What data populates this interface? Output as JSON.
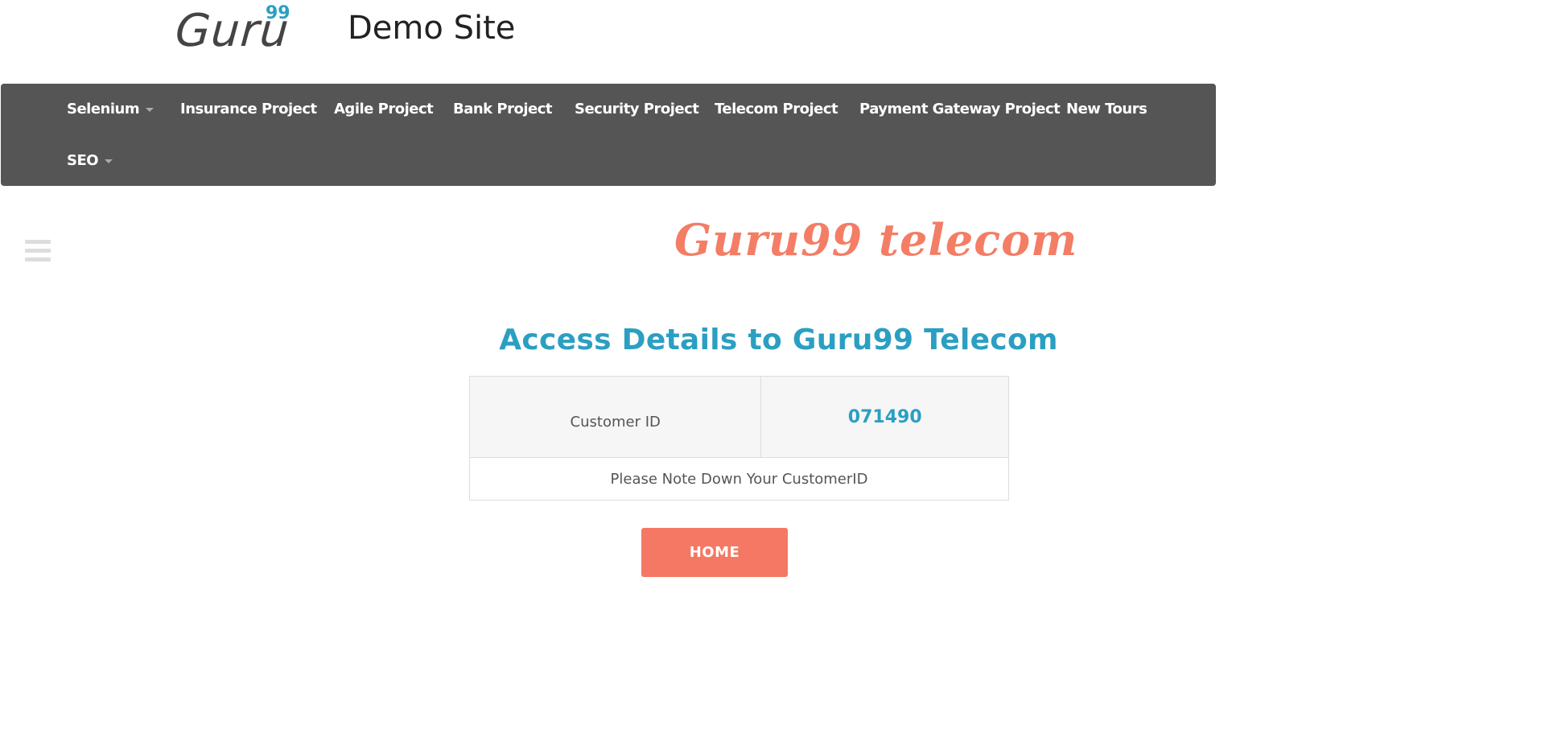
{
  "header": {
    "logo_text": "Guru",
    "logo_sup": "99",
    "site_title": "Demo Site"
  },
  "nav": {
    "items": [
      {
        "label": "Selenium",
        "dropdown": true
      },
      {
        "label": "Insurance Project",
        "dropdown": false
      },
      {
        "label": "Agile Project",
        "dropdown": false
      },
      {
        "label": "Bank Project",
        "dropdown": false
      },
      {
        "label": "Security Project",
        "dropdown": false
      },
      {
        "label": "Telecom Project",
        "dropdown": false
      },
      {
        "label": "Payment Gateway Project",
        "dropdown": false
      },
      {
        "label": "New Tours",
        "dropdown": false
      },
      {
        "label": "SEO",
        "dropdown": true
      }
    ]
  },
  "brand": {
    "text": "Guru99 telecom"
  },
  "main": {
    "title": "Access Details to Guru99 Telecom",
    "customer_id_label": "Customer ID",
    "customer_id_value": "071490",
    "note": "Please Note Down Your CustomerID",
    "home_button": "HOME"
  },
  "colors": {
    "accent_blue": "#2b9fc2",
    "accent_coral": "#f47863",
    "navbar_bg": "#555555"
  },
  "icons": {
    "menu": "hamburger-menu-icon",
    "dropdown": "caret-down-icon"
  }
}
